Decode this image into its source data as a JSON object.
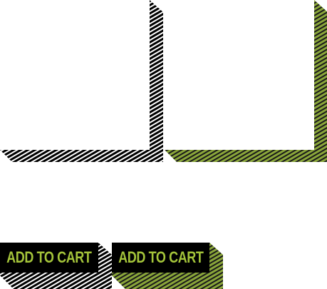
{
  "colors": {
    "accent": "#a4c43a",
    "shadow_dark": "#000000",
    "shadow_green": "#7f9a2f",
    "button_bg": "#000000",
    "page_bg": "#ffffff"
  },
  "frames": [
    {
      "pattern": "black-hatch"
    },
    {
      "pattern": "green-hatch"
    }
  ],
  "buttons": [
    {
      "label": "ADD TO CART",
      "shadow_pattern": "black-hatch"
    },
    {
      "label": "ADD TO CART",
      "shadow_pattern": "green-hatch"
    }
  ]
}
